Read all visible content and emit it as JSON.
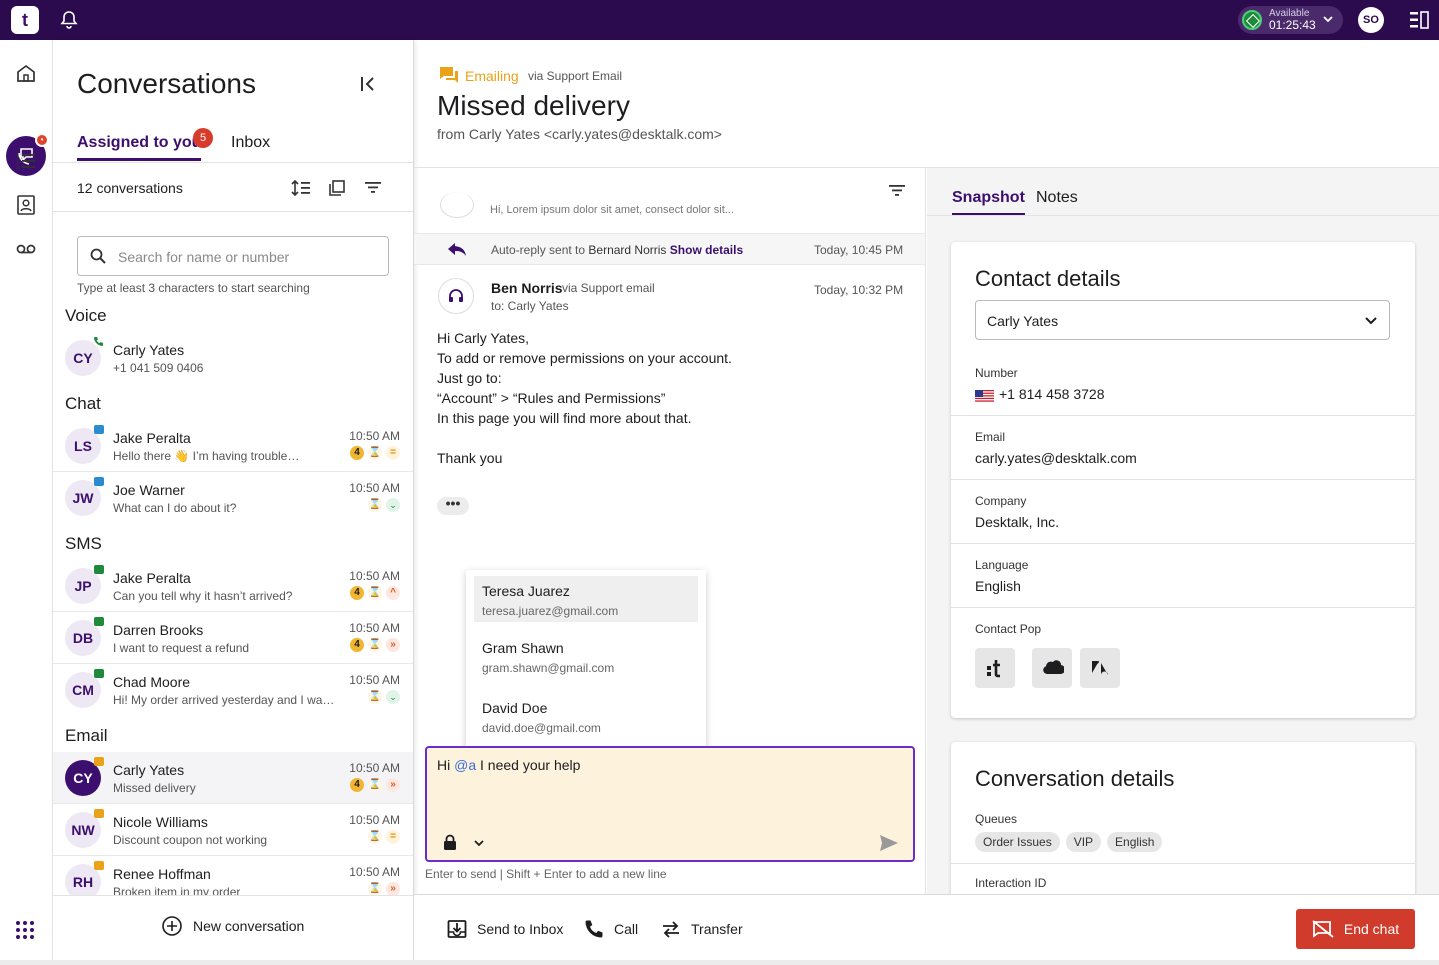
{
  "topbar": {
    "logo": "t",
    "status_label": "Available",
    "status_timer": "01:25:43",
    "user_initials": "SO"
  },
  "conversations": {
    "title": "Conversations",
    "tabs": [
      {
        "label": "Assigned to you",
        "badge": "5"
      },
      {
        "label": "Inbox"
      }
    ],
    "count_label": "12 conversations",
    "search": {
      "placeholder": "Search for name or number",
      "hint": "Type at least 3 characters to start searching"
    },
    "sections": [
      {
        "title": "Voice",
        "items": [
          {
            "initials": "CY",
            "name": "Carly Yates",
            "preview": "+1 041 509 0406",
            "time": "",
            "channel": "voice"
          }
        ]
      },
      {
        "title": "Chat",
        "items": [
          {
            "initials": "LS",
            "name": "Jake Peralta",
            "preview": "Hello there 👋 I’m having trouble…",
            "time": "10:50 AM",
            "count": "4",
            "priority": "medium"
          },
          {
            "initials": "JW",
            "name": "Joe Warner",
            "preview": "What can I do about it?",
            "time": "10:50 AM",
            "priority": "low"
          }
        ]
      },
      {
        "title": "SMS",
        "items": [
          {
            "initials": "JP",
            "name": "Jake Peralta",
            "preview": "Can you tell why it hasn’t arrived?",
            "time": "10:50 AM",
            "count": "4",
            "priority": "up"
          },
          {
            "initials": "DB",
            "name": "Darren Brooks",
            "preview": "I want to request a refund",
            "time": "10:50 AM",
            "count": "4",
            "priority": "high"
          },
          {
            "initials": "CM",
            "name": "Chad Moore",
            "preview": "Hi! My order arrived yesterday and I was…",
            "time": "10:50 AM",
            "priority": "low"
          }
        ]
      },
      {
        "title": "Email",
        "items": [
          {
            "initials": "CY",
            "name": "Carly Yates",
            "preview": "Missed delivery",
            "time": "10:50 AM",
            "count": "4",
            "priority": "high",
            "selected": true
          },
          {
            "initials": "NW",
            "name": "Nicole Williams",
            "preview": "Discount coupon not working",
            "time": "10:50 AM",
            "priority": "medium"
          },
          {
            "initials": "RH",
            "name": "Renee Hoffman",
            "preview": "Broken item in my order",
            "time": "10:50 AM",
            "priority": "high"
          }
        ]
      }
    ],
    "new_conversation": "New conversation"
  },
  "header": {
    "channel": "Emailing",
    "via": "via Support Email",
    "subject": "Missed delivery",
    "from": "from Carly Yates <carly.yates@desktalk.com>"
  },
  "messages": {
    "truncated_preview": "Hi, Lorem ipsum dolor sit amet, consect dolor sit...",
    "autoreply": {
      "prefix": "Auto-reply sent to",
      "name": "Bernard Norris",
      "link": "Show details",
      "time": "Today, 10:45 PM"
    },
    "message": {
      "sender": "Ben Norris",
      "via": "via Support email",
      "to": "to: Carly Yates",
      "time": "Today, 10:32 PM",
      "lines": [
        "Hi Carly Yates,",
        "To add or remove permissions on your account.",
        "Just go to:",
        "“Account” > “Rules and Permissions”",
        "In this page you will find more about that.",
        "",
        "Thank you"
      ]
    },
    "more": "•••"
  },
  "mention_suggestions": [
    {
      "name": "Teresa Juarez",
      "email": "teresa.juarez@gmail.com"
    },
    {
      "name": "Gram Shawn",
      "email": "gram.shawn@gmail.com"
    },
    {
      "name": "David Doe",
      "email": "david.doe@gmail.com"
    }
  ],
  "composer": {
    "text_before": "Hi ",
    "mention": "@a",
    "text_after": " I need your help",
    "hint": "Enter to send | Shift + Enter to add a new line"
  },
  "snapshot": {
    "tabs": [
      "Snapshot",
      "Notes"
    ],
    "contact_details": {
      "title": "Contact details",
      "selected_contact": "Carly Yates",
      "number_label": "Number",
      "number": "+1 814 458 3728",
      "email_label": "Email",
      "email": "carly.yates@desktalk.com",
      "company_label": "Company",
      "company": "Desktalk, Inc.",
      "language_label": "Language",
      "language": "English",
      "contact_pop_label": "Contact Pop"
    },
    "conversation_details": {
      "title": "Conversation details",
      "queues_label": "Queues",
      "queues": [
        "Order Issues",
        "VIP",
        "English"
      ],
      "interaction_id_label": "Interaction ID"
    }
  },
  "actions": {
    "send_to_inbox": "Send to Inbox",
    "call": "Call",
    "transfer": "Transfer",
    "end_chat": "End chat"
  },
  "colors": {
    "brand": "#3c0f6e",
    "topbar": "#2b0a4d",
    "accent_email": "#e9a21a",
    "danger": "#d13b2b",
    "composer_bg": "#fdf2dc"
  }
}
